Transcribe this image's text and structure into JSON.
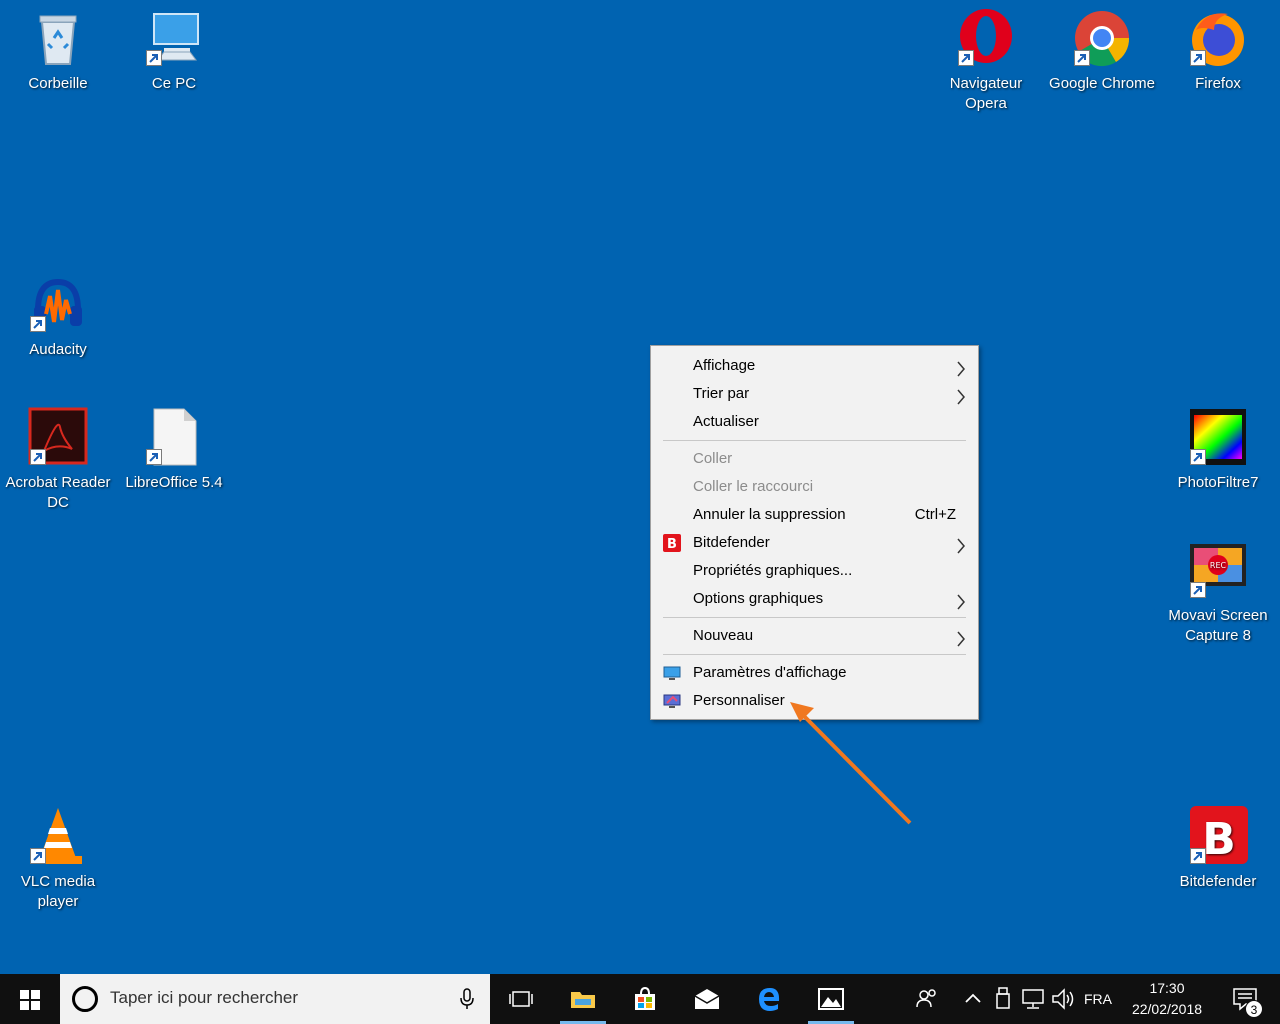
{
  "desktop": {
    "icons": {
      "corbeille": "Corbeille",
      "ce_pc": "Ce PC",
      "opera": "Navigateur Opera",
      "chrome": "Google Chrome",
      "firefox": "Firefox",
      "audacity": "Audacity",
      "acrobat": "Acrobat Reader DC",
      "libreoffice": "LibreOffice 5.4",
      "photofiltre": "PhotoFiltre7",
      "movavi": "Movavi Screen Capture 8",
      "vlc": "VLC media player",
      "bitdefender": "Bitdefender"
    },
    "movavi_badge": "REC"
  },
  "context_menu": {
    "affichage": "Affichage",
    "trier_par": "Trier par",
    "actualiser": "Actualiser",
    "coller": "Coller",
    "coller_raccourci": "Coller le raccourci",
    "annuler": "Annuler la suppression",
    "annuler_shortcut": "Ctrl+Z",
    "bitdefender": "Bitdefender",
    "proprietes": "Propriétés graphiques...",
    "options": "Options graphiques",
    "nouveau": "Nouveau",
    "parametres": "Paramètres d'affichage",
    "personnaliser": "Personnaliser"
  },
  "taskbar": {
    "search_placeholder": "Taper ici pour rechercher",
    "language": "FRA",
    "time": "17:30",
    "date": "22/02/2018",
    "notification_count": "3"
  },
  "colors": {
    "desktop": "#0063b1",
    "annotation_arrow": "#f07820",
    "taskbar": "#101010"
  }
}
